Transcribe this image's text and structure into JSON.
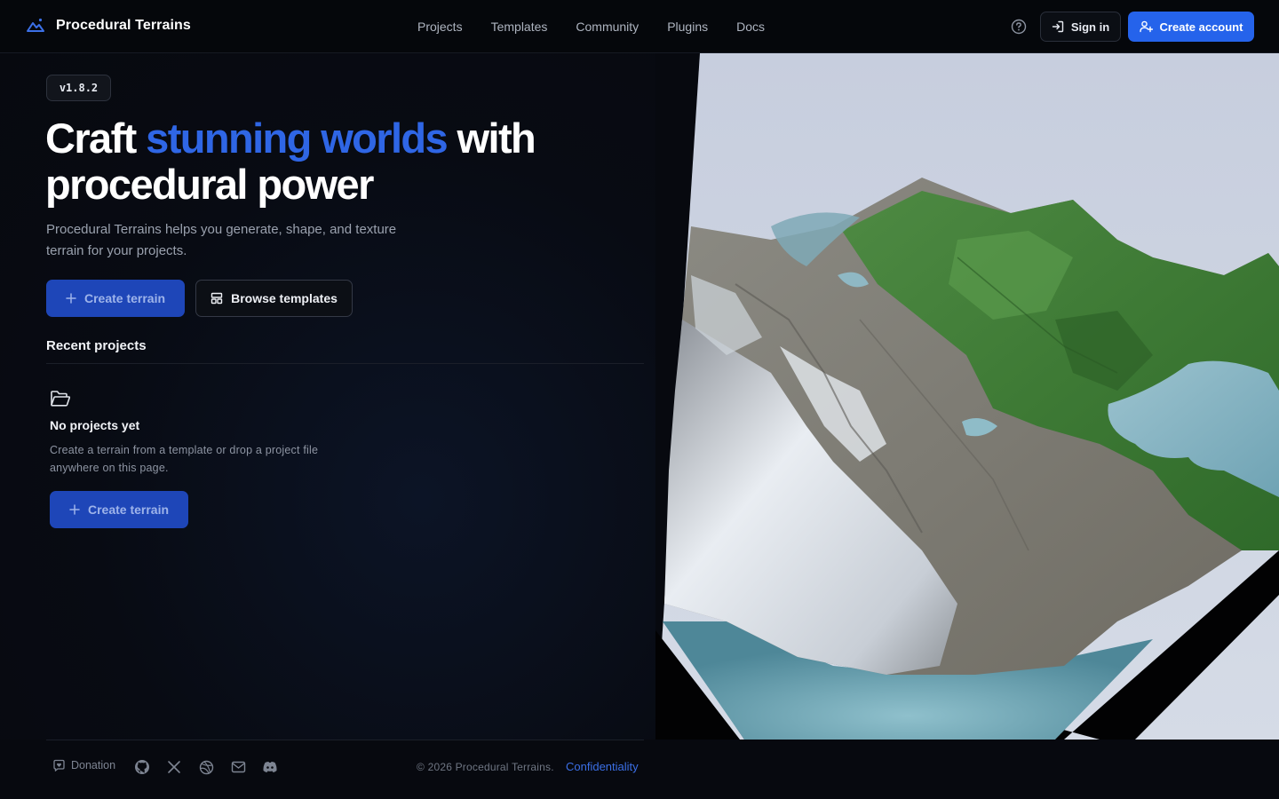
{
  "header": {
    "brand": "Procedural Terrains",
    "nav": [
      "Projects",
      "Templates",
      "Community",
      "Plugins",
      "Docs"
    ],
    "sign_in": "Sign in",
    "create_account": "Create account"
  },
  "hero": {
    "version": "v1.8.2",
    "title_start": "Craft",
    "title_accent": "stunning worlds",
    "title_end": "with",
    "title_line2": "procedural power",
    "subtitle": "Procedural Terrains helps you generate, shape, and texture terrain for your projects.",
    "create_terrain": "Create terrain",
    "browse_templates": "Browse templates"
  },
  "recent": {
    "title": "Recent projects",
    "empty_title": "No projects yet",
    "empty_desc": "Create a terrain from a template or drop a project file anywhere on this page.",
    "create_terrain": "Create terrain"
  },
  "footer": {
    "donation": "Donation",
    "social_icons": [
      "github-icon",
      "x-icon",
      "dribbble-icon",
      "mail-icon",
      "discord-icon"
    ],
    "copyright": "© 2026 Procedural Terrains.",
    "confidentiality": "Confidentiality"
  },
  "colors": {
    "accent": "#2563eb",
    "background": "#07090f"
  }
}
